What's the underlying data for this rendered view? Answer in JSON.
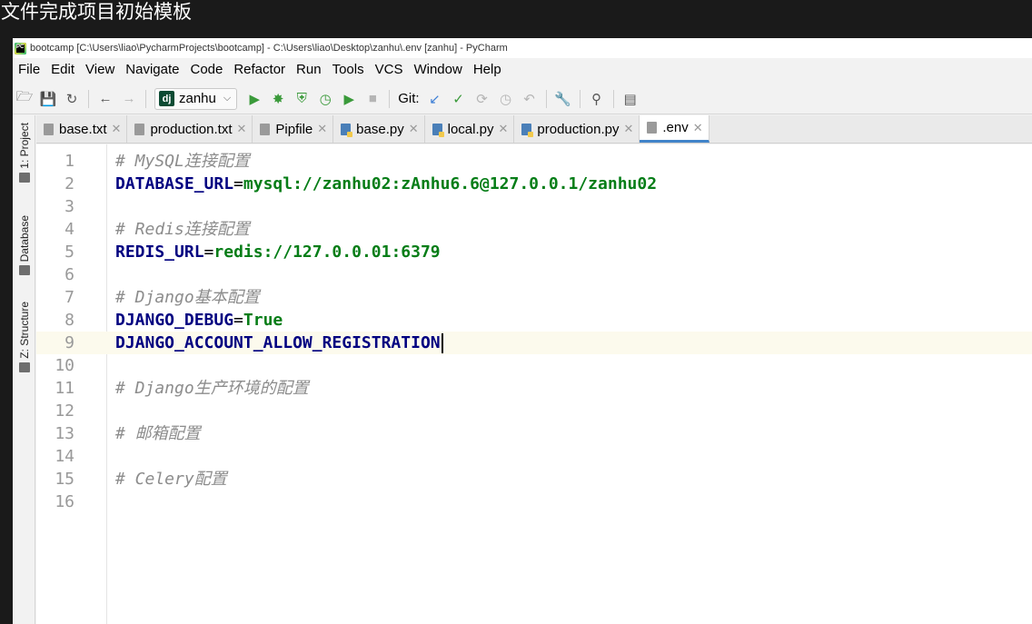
{
  "overlay_caption": "文件完成项目初始模板",
  "window": {
    "title": "bootcamp [C:\\Users\\liao\\PycharmProjects\\bootcamp] - C:\\Users\\liao\\Desktop\\zanhu\\.env [zanhu] - PyCharm"
  },
  "menu": [
    "File",
    "Edit",
    "View",
    "Navigate",
    "Code",
    "Refactor",
    "Run",
    "Tools",
    "VCS",
    "Window",
    "Help"
  ],
  "toolbar": {
    "run_config": "zanhu",
    "run_config_icon": "dj",
    "git_label": "Git:"
  },
  "tool_windows": {
    "project": "1: Project",
    "database": "Database",
    "structure": "Z: Structure"
  },
  "tabs": [
    {
      "label": "base.txt",
      "type": "txt"
    },
    {
      "label": "production.txt",
      "type": "txt"
    },
    {
      "label": "Pipfile",
      "type": "txt"
    },
    {
      "label": "base.py",
      "type": "py"
    },
    {
      "label": "local.py",
      "type": "py"
    },
    {
      "label": "production.py",
      "type": "py"
    },
    {
      "label": ".env",
      "type": "env",
      "active": true
    }
  ],
  "editor": {
    "current_line": 9,
    "lines": [
      {
        "n": "1",
        "comment": "# MySQL连接配置"
      },
      {
        "n": "2",
        "key": "DATABASE_URL",
        "eq": "=",
        "val": "mysql://zanhu02:zAnhu6.6@127.0.0.1/zanhu02"
      },
      {
        "n": "3"
      },
      {
        "n": "4",
        "comment": "# Redis连接配置"
      },
      {
        "n": "5",
        "key": "REDIS_URL",
        "eq": "=",
        "val": "redis://127.0.0.01:6379"
      },
      {
        "n": "6"
      },
      {
        "n": "7",
        "comment": "# Django基本配置"
      },
      {
        "n": "8",
        "key": "DJANGO_DEBUG",
        "eq": "=",
        "val": "True"
      },
      {
        "n": "9",
        "key": "DJANGO_ACCOUNT_ALLOW_REGISTRATION"
      },
      {
        "n": "10"
      },
      {
        "n": "11",
        "comment": "# Django生产环境的配置"
      },
      {
        "n": "12"
      },
      {
        "n": "13",
        "comment": "# 邮箱配置"
      },
      {
        "n": "14"
      },
      {
        "n": "15",
        "comment": "# Celery配置"
      },
      {
        "n": "16"
      }
    ]
  }
}
